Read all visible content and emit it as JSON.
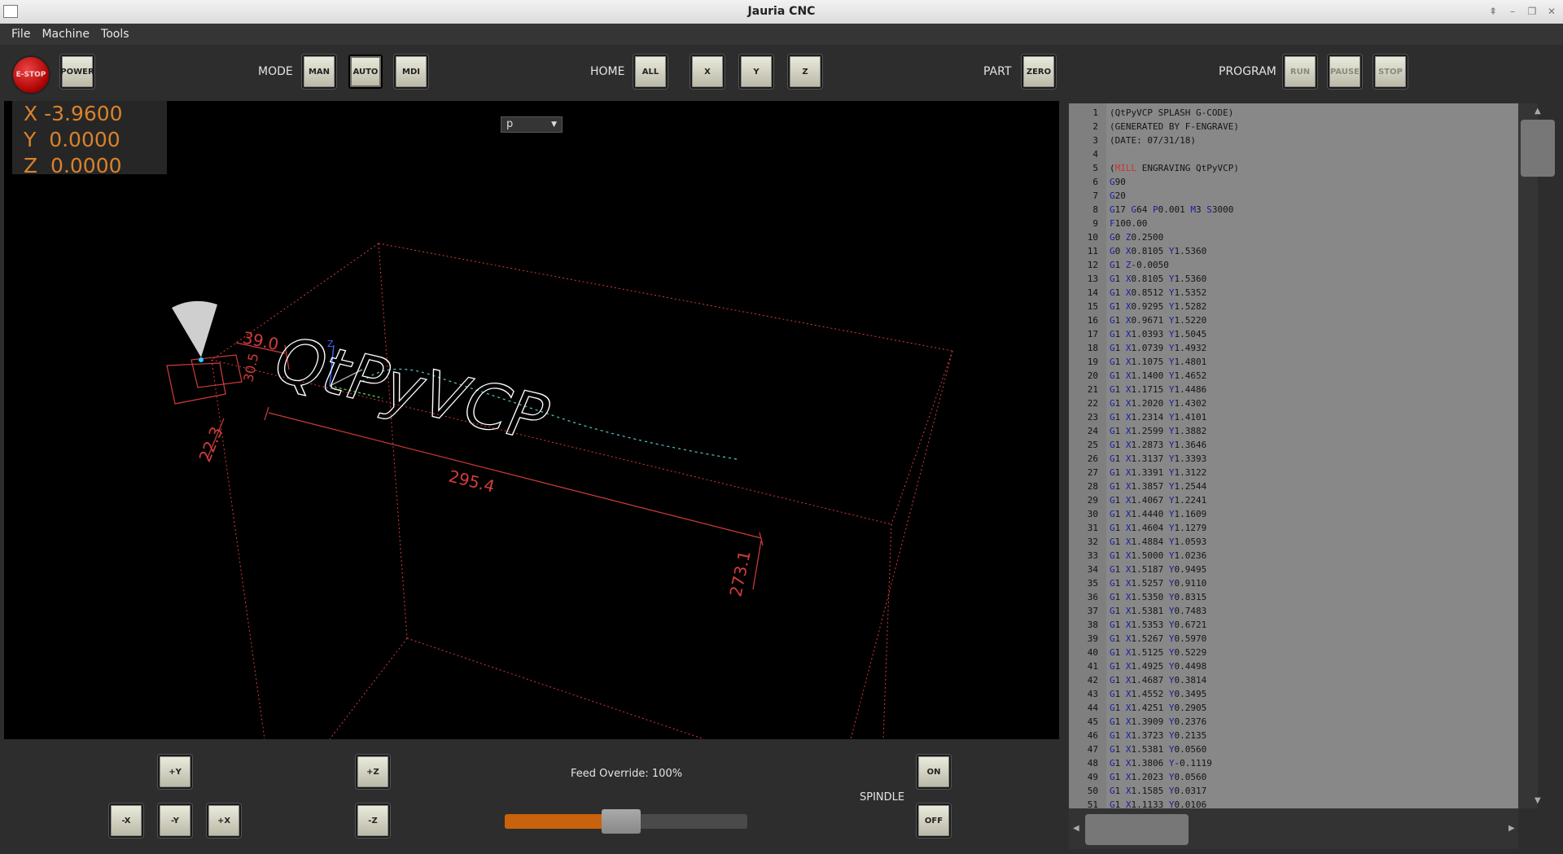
{
  "window": {
    "title": "Jauria CNC"
  },
  "menu": {
    "items": [
      "File",
      "Machine",
      "Tools"
    ]
  },
  "toolbar": {
    "estop_label": "E-STOP",
    "power_label": "POWER",
    "mode": {
      "label": "MODE",
      "buttons": [
        "MAN",
        "AUTO",
        "MDI"
      ],
      "active": "AUTO"
    },
    "home": {
      "label": "HOME",
      "buttons": [
        "ALL",
        "X",
        "Y",
        "Z"
      ]
    },
    "part": {
      "label": "PART",
      "button": "ZERO"
    },
    "program": {
      "label": "PROGRAM",
      "buttons": [
        "RUN",
        "PAUSE",
        "STOP"
      ]
    }
  },
  "dro": {
    "x": {
      "axis": "X",
      "value": "-3.9600"
    },
    "y": {
      "axis": "Y",
      "value": "0.0000"
    },
    "z": {
      "axis": "Z",
      "value": "0.0000"
    }
  },
  "viewport": {
    "view_select": "p",
    "dimensions": {
      "height": "39.0",
      "depth_small": "30.5",
      "depth": "22.3",
      "width": "295.4",
      "length": "273.1"
    },
    "tool_label": "Z",
    "toolpath_text": "QtPyVCP"
  },
  "gcode": [
    {
      "n": "1",
      "text": "(QtPyVCP SPLASH G-CODE)"
    },
    {
      "n": "2",
      "text": "(GENERATED BY F-ENGRAVE)"
    },
    {
      "n": "3",
      "text": "(DATE: 07/31/18)"
    },
    {
      "n": "4",
      "text": ""
    },
    {
      "n": "5",
      "text": "(MILL ENGRAVING QtPyVCP)"
    },
    {
      "n": "6",
      "text": "G90"
    },
    {
      "n": "7",
      "text": "G20"
    },
    {
      "n": "8",
      "text": "G17 G64 P0.001 M3 S3000"
    },
    {
      "n": "9",
      "text": "F100.00"
    },
    {
      "n": "10",
      "text": "G0 Z0.2500"
    },
    {
      "n": "11",
      "text": "G0 X0.8105 Y1.5360"
    },
    {
      "n": "12",
      "text": "G1 Z-0.0050"
    },
    {
      "n": "13",
      "text": "G1 X0.8105 Y1.5360"
    },
    {
      "n": "14",
      "text": "G1 X0.8512 Y1.5352"
    },
    {
      "n": "15",
      "text": "G1 X0.9295 Y1.5282"
    },
    {
      "n": "16",
      "text": "G1 X0.9671 Y1.5220"
    },
    {
      "n": "17",
      "text": "G1 X1.0393 Y1.5045"
    },
    {
      "n": "18",
      "text": "G1 X1.0739 Y1.4932"
    },
    {
      "n": "19",
      "text": "G1 X1.1075 Y1.4801"
    },
    {
      "n": "20",
      "text": "G1 X1.1400 Y1.4652"
    },
    {
      "n": "21",
      "text": "G1 X1.1715 Y1.4486"
    },
    {
      "n": "22",
      "text": "G1 X1.2020 Y1.4302"
    },
    {
      "n": "23",
      "text": "G1 X1.2314 Y1.4101"
    },
    {
      "n": "24",
      "text": "G1 X1.2599 Y1.3882"
    },
    {
      "n": "25",
      "text": "G1 X1.2873 Y1.3646"
    },
    {
      "n": "26",
      "text": "G1 X1.3137 Y1.3393"
    },
    {
      "n": "27",
      "text": "G1 X1.3391 Y1.3122"
    },
    {
      "n": "28",
      "text": "G1 X1.3857 Y1.2544"
    },
    {
      "n": "29",
      "text": "G1 X1.4067 Y1.2241"
    },
    {
      "n": "30",
      "text": "G1 X1.4440 Y1.1609"
    },
    {
      "n": "31",
      "text": "G1 X1.4604 Y1.1279"
    },
    {
      "n": "32",
      "text": "G1 X1.4884 Y1.0593"
    },
    {
      "n": "33",
      "text": "G1 X1.5000 Y1.0236"
    },
    {
      "n": "34",
      "text": "G1 X1.5187 Y0.9495"
    },
    {
      "n": "35",
      "text": "G1 X1.5257 Y0.9110"
    },
    {
      "n": "36",
      "text": "G1 X1.5350 Y0.8315"
    },
    {
      "n": "37",
      "text": "G1 X1.5381 Y0.7483"
    },
    {
      "n": "38",
      "text": "G1 X1.5353 Y0.6721"
    },
    {
      "n": "39",
      "text": "G1 X1.5267 Y0.5970"
    },
    {
      "n": "40",
      "text": "G1 X1.5125 Y0.5229"
    },
    {
      "n": "41",
      "text": "G1 X1.4925 Y0.4498"
    },
    {
      "n": "42",
      "text": "G1 X1.4687 Y0.3814"
    },
    {
      "n": "43",
      "text": "G1 X1.4552 Y0.3495"
    },
    {
      "n": "44",
      "text": "G1 X1.4251 Y0.2905"
    },
    {
      "n": "45",
      "text": "G1 X1.3909 Y0.2376"
    },
    {
      "n": "46",
      "text": "G1 X1.3723 Y0.2135"
    },
    {
      "n": "47",
      "text": "G1 X1.5381 Y0.0560"
    },
    {
      "n": "48",
      "text": "G1 X1.3806 Y-0.1119"
    },
    {
      "n": "49",
      "text": "G1 X1.2023 Y0.0560"
    },
    {
      "n": "50",
      "text": "G1 X1.1585 Y0.0317"
    },
    {
      "n": "51",
      "text": "G1 X1.1133 Y0.0106"
    }
  ],
  "jog": {
    "y_plus": "+Y",
    "y_minus": "-Y",
    "x_minus": "-X",
    "x_plus": "+X",
    "z_plus": "+Z",
    "z_minus": "-Z"
  },
  "feed": {
    "label": "Feed Override: 100%",
    "percent": 100,
    "fraction": 0.4
  },
  "spindle": {
    "label": "SPINDLE",
    "on": "ON",
    "off": "OFF"
  },
  "colors": {
    "accent": "#d9822b",
    "slider": "#c8620c",
    "bbox": "#d23c3c",
    "letters": "#ffffff",
    "code_blue": "#1a1aa6"
  }
}
